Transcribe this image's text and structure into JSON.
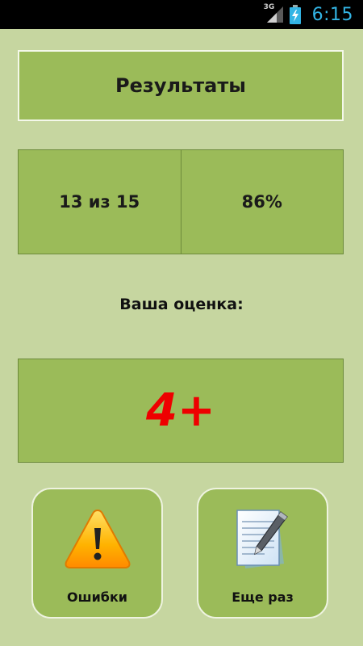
{
  "status_bar": {
    "network": "3G",
    "time": "6:15"
  },
  "header": {
    "title": "Результаты"
  },
  "score": {
    "correct_of_total": "13 из 15",
    "percent": "86%"
  },
  "grade": {
    "label": "Ваша оценка:",
    "value": "4+",
    "color": "#ee0000"
  },
  "actions": {
    "errors_label": "Ошибки",
    "retry_label": "Еще раз"
  },
  "colors": {
    "background": "#c6d6a0",
    "panel": "#9bbb59",
    "clock": "#33b5e5"
  },
  "icons": {
    "errors": "warning-icon",
    "retry": "document-pen-icon"
  }
}
